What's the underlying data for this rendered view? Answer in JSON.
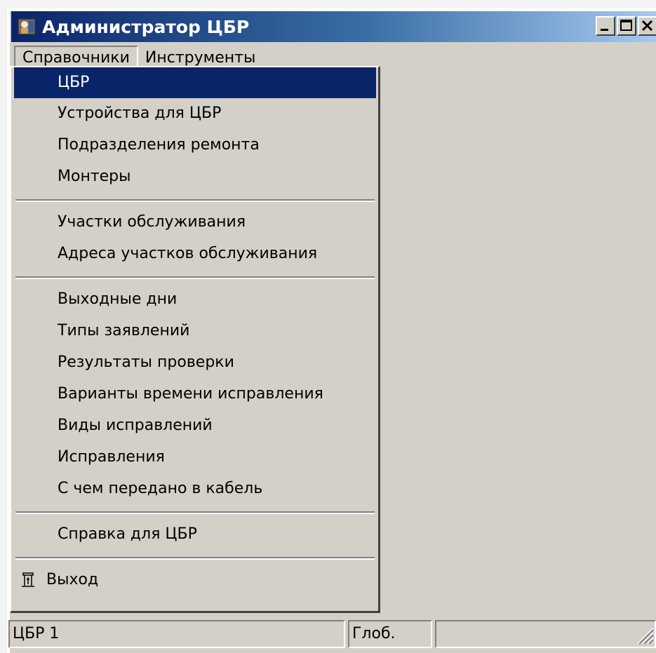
{
  "window": {
    "title": "Администратор ЦБР",
    "icon": "app-icon",
    "controls": [
      "minimize-icon",
      "maximize-icon",
      "close-icon"
    ]
  },
  "menubar": {
    "items": [
      {
        "label": "Справочники",
        "active": true
      },
      {
        "label": "Инструменты",
        "active": false
      }
    ]
  },
  "dropdown": {
    "groups": [
      [
        "ЦБР",
        "Устройства для ЦБР",
        "Подразделения ремонта",
        "Монтеры"
      ],
      [
        "Участки обслуживания",
        "Адреса участков обслуживания"
      ],
      [
        "Выходные дни",
        "Типы заявлений",
        "Результаты проверки",
        "Варианты времени исправления",
        "Виды исправлений",
        "Исправления",
        "С чем передано в кабель"
      ],
      [
        "Справка для ЦБР"
      ]
    ],
    "selected": "ЦБР",
    "exit_label": "Выход",
    "exit_icon": "exit-door-icon"
  },
  "statusbar": {
    "panels": [
      "ЦБР 1",
      "Глоб.",
      ""
    ]
  },
  "colors": {
    "face": "#d4d0c8",
    "selection": "#0a246a",
    "title_start": "#0a246a",
    "title_end": "#a6caf0"
  }
}
